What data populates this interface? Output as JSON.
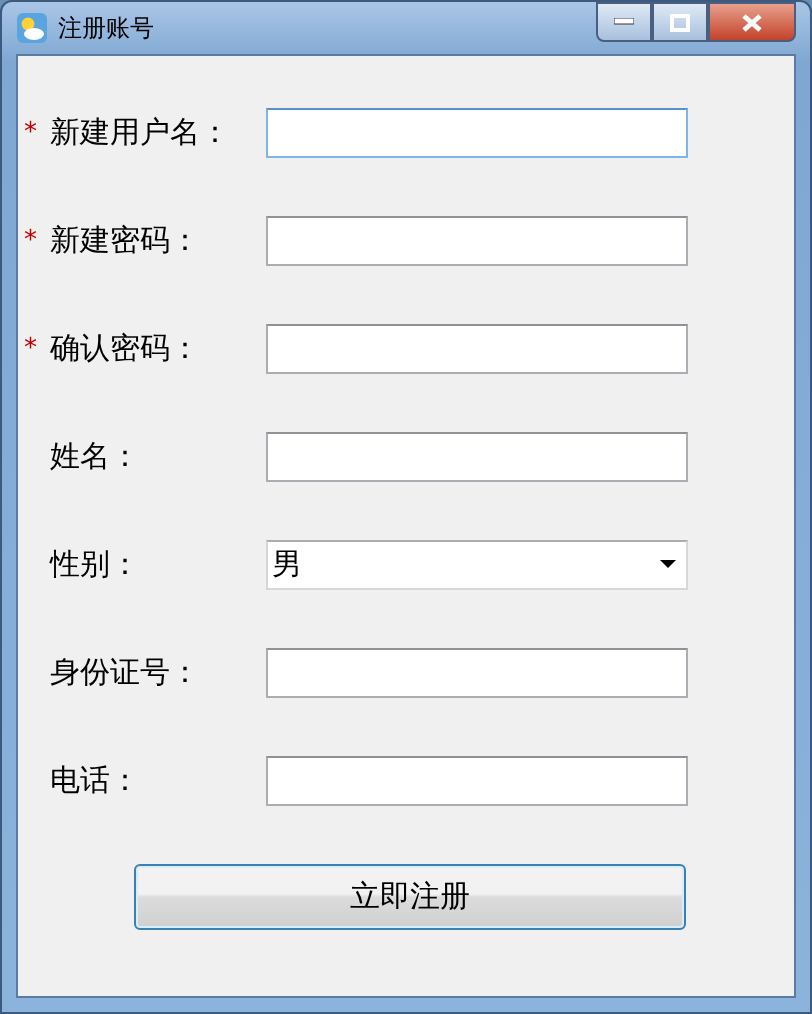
{
  "window": {
    "title": "注册账号"
  },
  "fields": [
    {
      "required_mark": "*",
      "label": "新建用户名：",
      "kind": "text",
      "focused": true
    },
    {
      "required_mark": "*",
      "label": "新建密码：",
      "kind": "text",
      "focused": false
    },
    {
      "required_mark": "*",
      "label": "确认密码：",
      "kind": "text",
      "focused": false
    },
    {
      "label": "姓名：",
      "kind": "text",
      "focused": false
    },
    {
      "label": "性别：",
      "kind": "select",
      "value": "男",
      "focused": false
    },
    {
      "label": "身份证号：",
      "kind": "text",
      "focused": false
    },
    {
      "label": "电话：",
      "kind": "text",
      "focused": false
    }
  ],
  "submit_button": "立即注册"
}
